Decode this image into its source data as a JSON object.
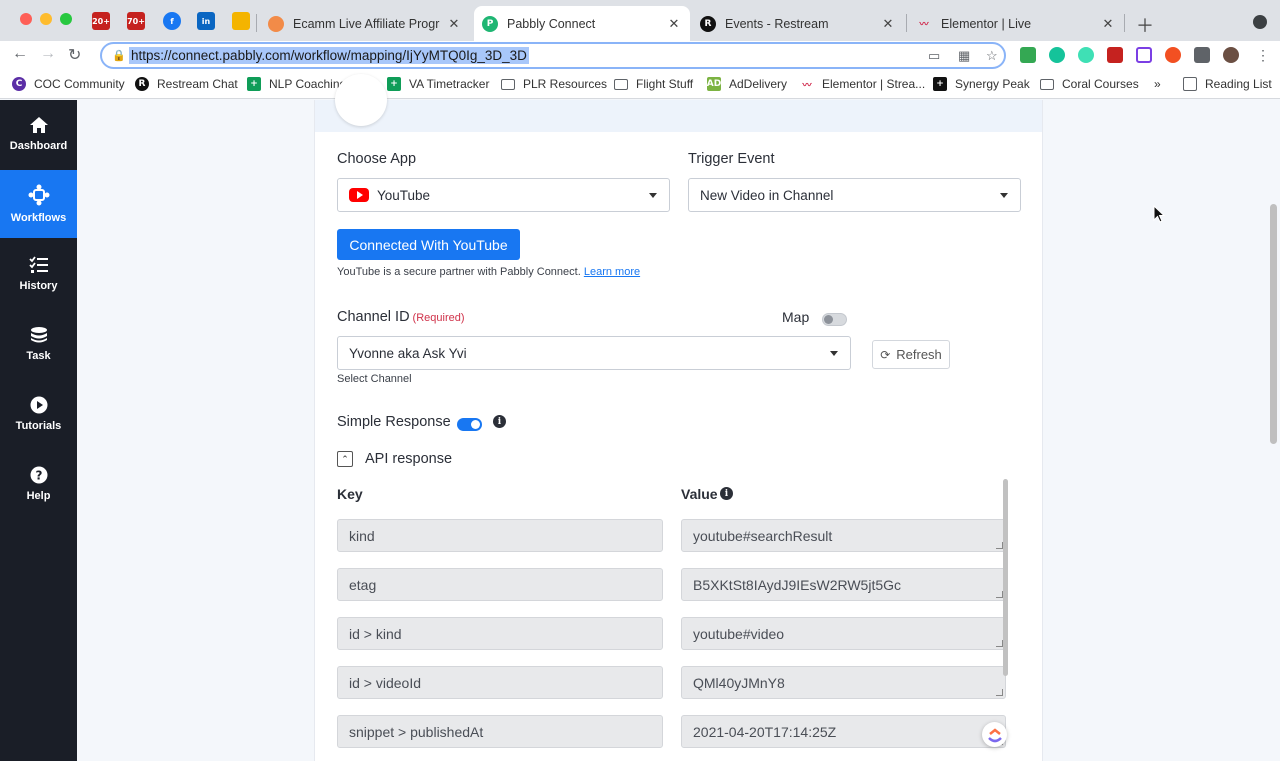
{
  "browser": {
    "tabs": [
      {
        "title": "Ecamm Live Affiliate Program |"
      },
      {
        "title": "Pabbly Connect"
      },
      {
        "title": "Events - Restream"
      },
      {
        "title": "Elementor | Live"
      }
    ],
    "pinned_badges": [
      "20+",
      "70+"
    ],
    "url": "https://connect.pabbly.com/workflow/mapping/IjYyMTQ0Ig_3D_3D",
    "bookmarks": [
      "COC Community",
      "Restream Chat",
      "NLP Coaching Ass...",
      "VA Timetracker",
      "PLR Resources",
      "Flight Stuff",
      "AdDelivery",
      "Elementor | Strea...",
      "Synergy Peak",
      "Coral Courses"
    ],
    "bookmarks_overflow": "»",
    "reading_list": "Reading List"
  },
  "sidebar": {
    "items": [
      {
        "label": "Dashboard",
        "icon": "home-icon"
      },
      {
        "label": "Workflows",
        "icon": "workflow-icon"
      },
      {
        "label": "History",
        "icon": "history-icon"
      },
      {
        "label": "Task",
        "icon": "task-icon"
      },
      {
        "label": "Tutorials",
        "icon": "play-icon"
      },
      {
        "label": "Help",
        "icon": "help-icon"
      }
    ],
    "active": "Workflows"
  },
  "form": {
    "choose_app_label": "Choose App",
    "choose_app_value": "YouTube",
    "trigger_event_label": "Trigger Event",
    "trigger_event_value": "New Video in Channel",
    "connect_button": "Connected With YouTube",
    "secure_note": "YouTube is a secure partner with Pabbly Connect.",
    "learn_more": "Learn more",
    "channel_label": "Channel ID",
    "required_tag": "(Required)",
    "map_label": "Map",
    "map_enabled": false,
    "channel_value": "Yvonne aka Ask Yvi",
    "channel_help": "Select Channel",
    "refresh_label": "Refresh",
    "simple_response_label": "Simple Response",
    "simple_response_enabled": true,
    "api_response_label": "API response",
    "key_header": "Key",
    "value_header": "Value",
    "rows": [
      {
        "key": "kind",
        "value": "youtube#searchResult"
      },
      {
        "key": "etag",
        "value": "B5XKtSt8IAydJ9IEsW2RW5jt5Gc"
      },
      {
        "key": "id > kind",
        "value": "youtube#video"
      },
      {
        "key": "id > videoId",
        "value": "QMl40yJMnY8"
      },
      {
        "key": "snippet > publishedAt",
        "value": "2021-04-20T17:14:25Z"
      }
    ]
  },
  "colors": {
    "accent": "#1877f2",
    "sidebar_bg": "#1a1e27",
    "youtube_red": "#ff0000",
    "required_red": "#d0324a"
  }
}
